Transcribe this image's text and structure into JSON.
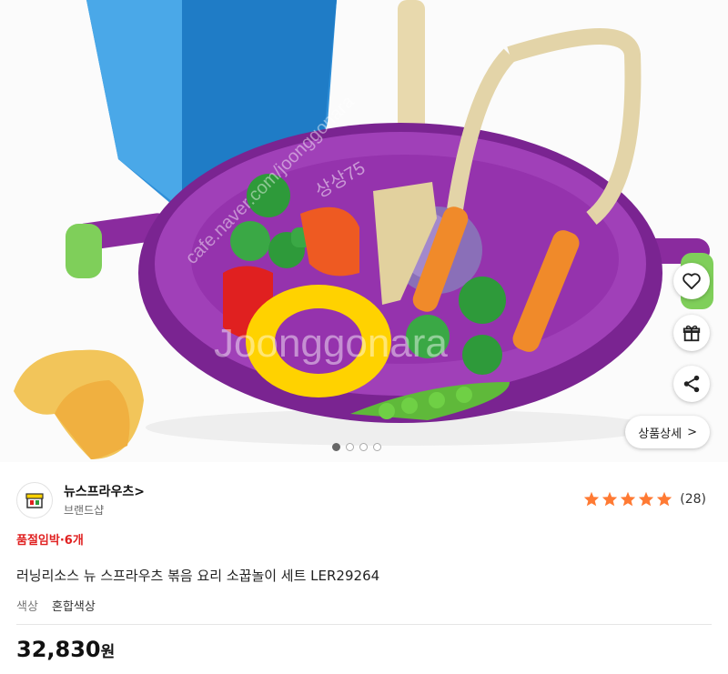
{
  "image": {
    "watermark_a": "Joonggonara",
    "watermark_b": "cafe.naver.com/joonggonara",
    "watermark_c": "상상75",
    "carousel": {
      "count": 4,
      "active": 0
    }
  },
  "actions": {
    "heart_icon": "heart-outline-icon",
    "gift_icon": "gift-icon",
    "share_icon": "share-icon",
    "detail_label": "상품상세",
    "detail_arrow": ">"
  },
  "brand": {
    "name": "뉴스프라우츠>",
    "subtitle": "브랜드샵",
    "rating_stars": 5,
    "review_count": "(28)",
    "star_color": "#ff7a33"
  },
  "product": {
    "stock_notice": "품절임박·6개",
    "title": "러닝리소스 뉴 스프라우츠 볶음 요리 소꿉놀이 세트 LER29264",
    "option_label": "색상",
    "option_value": "혼합색상",
    "price": "32,830",
    "price_unit": "원"
  },
  "colors": {
    "accent_red": "#e02020",
    "wok_purple": "#8a2b9e"
  }
}
